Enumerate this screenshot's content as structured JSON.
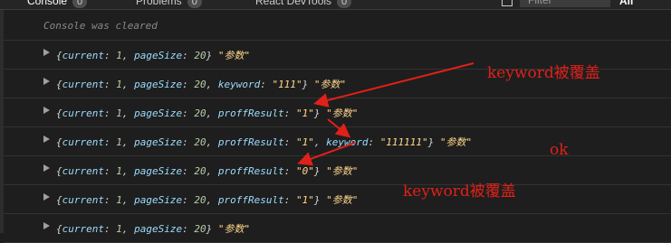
{
  "tabs": [
    {
      "label": "Console",
      "count": "0"
    },
    {
      "label": "Problems",
      "count": "0"
    },
    {
      "label": "React DevTools",
      "count": "0"
    }
  ],
  "filter": {
    "placeholder": "Filter"
  },
  "levels_label": "All",
  "cleared_message": "Console was cleared",
  "rows": [
    {
      "text": "{current: 1, pageSize: 20} \"参数\""
    },
    {
      "text": "{current: 1, pageSize: 20, keyword: \"111\"} \"参数\""
    },
    {
      "text": "{current: 1, pageSize: 20, proffResult: \"1\"} \"参数\""
    },
    {
      "text": "{current: 1, pageSize: 20, proffResult: \"1\", keyword: \"111111\"} \"参数\""
    },
    {
      "text": "{current: 1, pageSize: 20, proffResult: \"0\"} \"参数\""
    },
    {
      "text": "{current: 1, pageSize: 20, proffResult: \"1\"} \"参数\""
    },
    {
      "text": "{current: 1, pageSize: 20} \"参数\""
    }
  ],
  "annotations": {
    "top": "keyword被覆盖",
    "ok": "ok",
    "bottom": "keyword被覆盖"
  },
  "annotation_color": "#e0201a"
}
